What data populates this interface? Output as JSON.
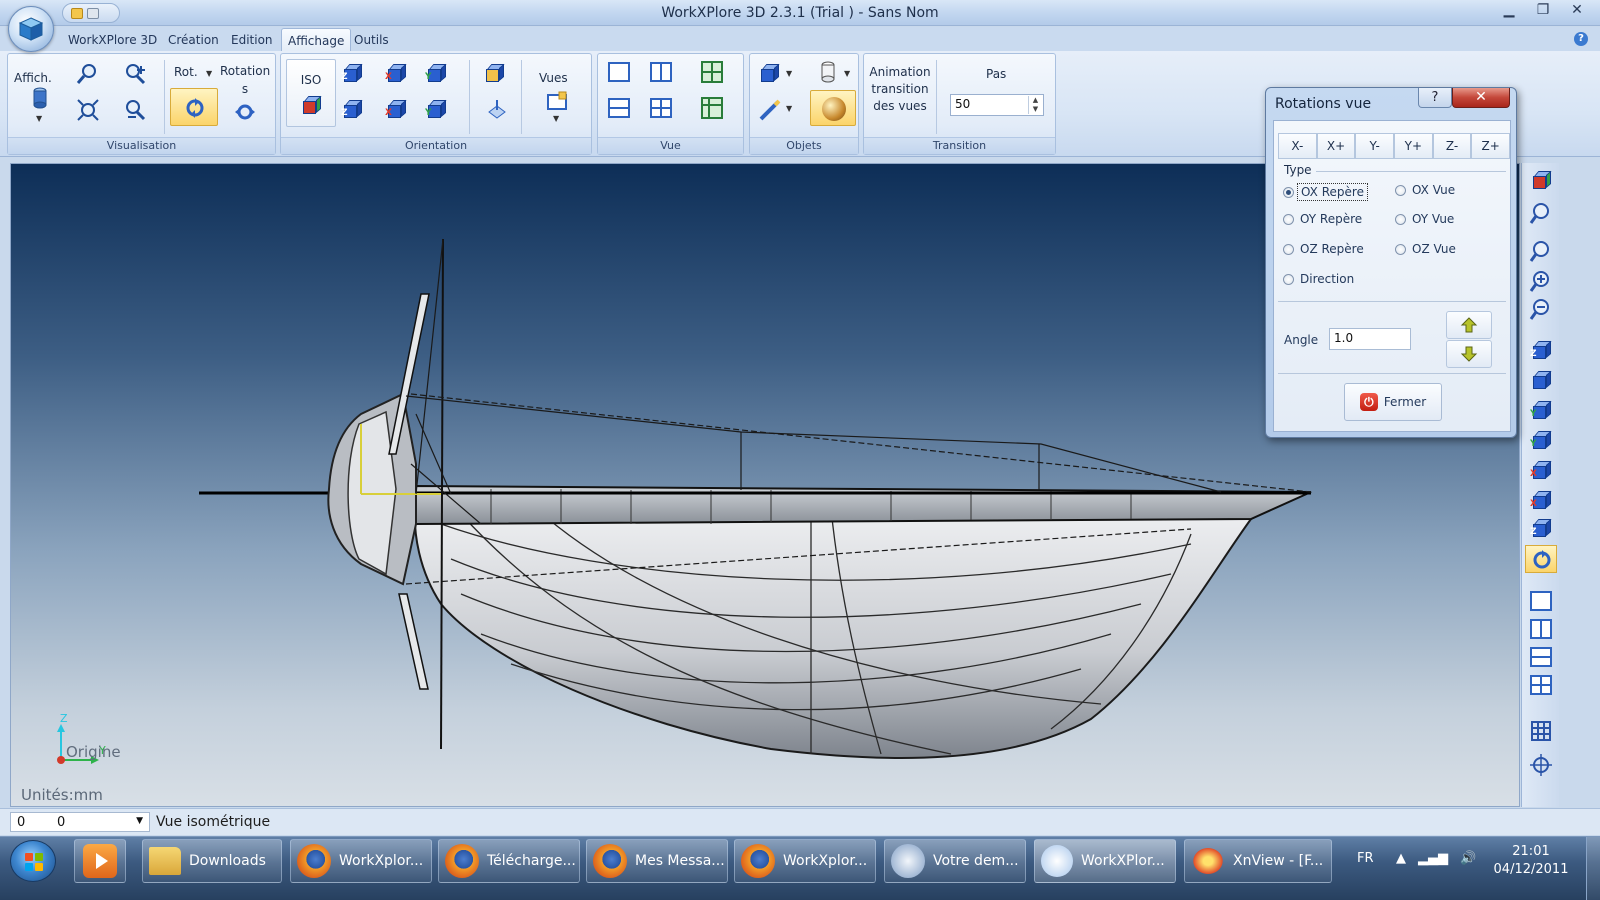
{
  "window": {
    "title": "WorkXPlore 3D 2.3.1 (Trial ) - Sans Nom",
    "minimize": "▁",
    "maximize": "❐",
    "close": "✕"
  },
  "ribbon": {
    "tabs": [
      {
        "label": "WorkXPlore 3D"
      },
      {
        "label": "Création"
      },
      {
        "label": "Edition"
      },
      {
        "label": "Affichage",
        "active": true
      },
      {
        "label": "Outils"
      }
    ],
    "groups": {
      "visualisation": {
        "label": "Visualisation",
        "affich": "Affich.",
        "rot": "Rot.",
        "rotation": "Rotation s"
      },
      "orientation": {
        "label": "Orientation",
        "iso": "ISO",
        "vues": "Vues"
      },
      "vue": {
        "label": "Vue"
      },
      "objets": {
        "label": "Objets"
      },
      "transition": {
        "label": "Transition",
        "animation": "Animation transition des vues",
        "pas": "Pas",
        "pas_value": "50"
      }
    }
  },
  "viewport": {
    "units": "Unités:mm",
    "origin": "Origine",
    "axis_z": "Z",
    "axis_y": "Y"
  },
  "status": {
    "coord_a": "0",
    "coord_b": "0",
    "view": "Vue isométrique"
  },
  "dialog": {
    "title": "Rotations vue",
    "help": "?",
    "close": "✕",
    "axes": [
      "X-",
      "X+",
      "Y-",
      "Y+",
      "Z-",
      "Z+"
    ],
    "type_label": "Type",
    "options": {
      "ox_repere": "OX Repère",
      "ox_vue": "OX Vue",
      "oy_repere": "OY Repère",
      "oy_vue": "OY Vue",
      "oz_repere": "OZ Repère",
      "oz_vue": "OZ Vue",
      "direction": "Direction"
    },
    "selected": "ox_repere",
    "angle_label": "Angle",
    "angle_value": "1.0",
    "fermer": "Fermer"
  },
  "taskbar": {
    "items": [
      {
        "label": "Downloads"
      },
      {
        "label": "WorkXplor..."
      },
      {
        "label": "Télécharge..."
      },
      {
        "label": "Mes Messa..."
      },
      {
        "label": "WorkXplor..."
      },
      {
        "label": "Votre dem..."
      },
      {
        "label": "WorkXPlor..."
      },
      {
        "label": "XnView - [F..."
      }
    ],
    "lang": "FR",
    "time": "21:01",
    "date": "04/12/2011"
  },
  "colors": {
    "accent": "#2e63c0",
    "viewport_top": "#0d2e57",
    "viewport_bottom": "#d8dfe6",
    "dialog_close": "#c4473a"
  }
}
